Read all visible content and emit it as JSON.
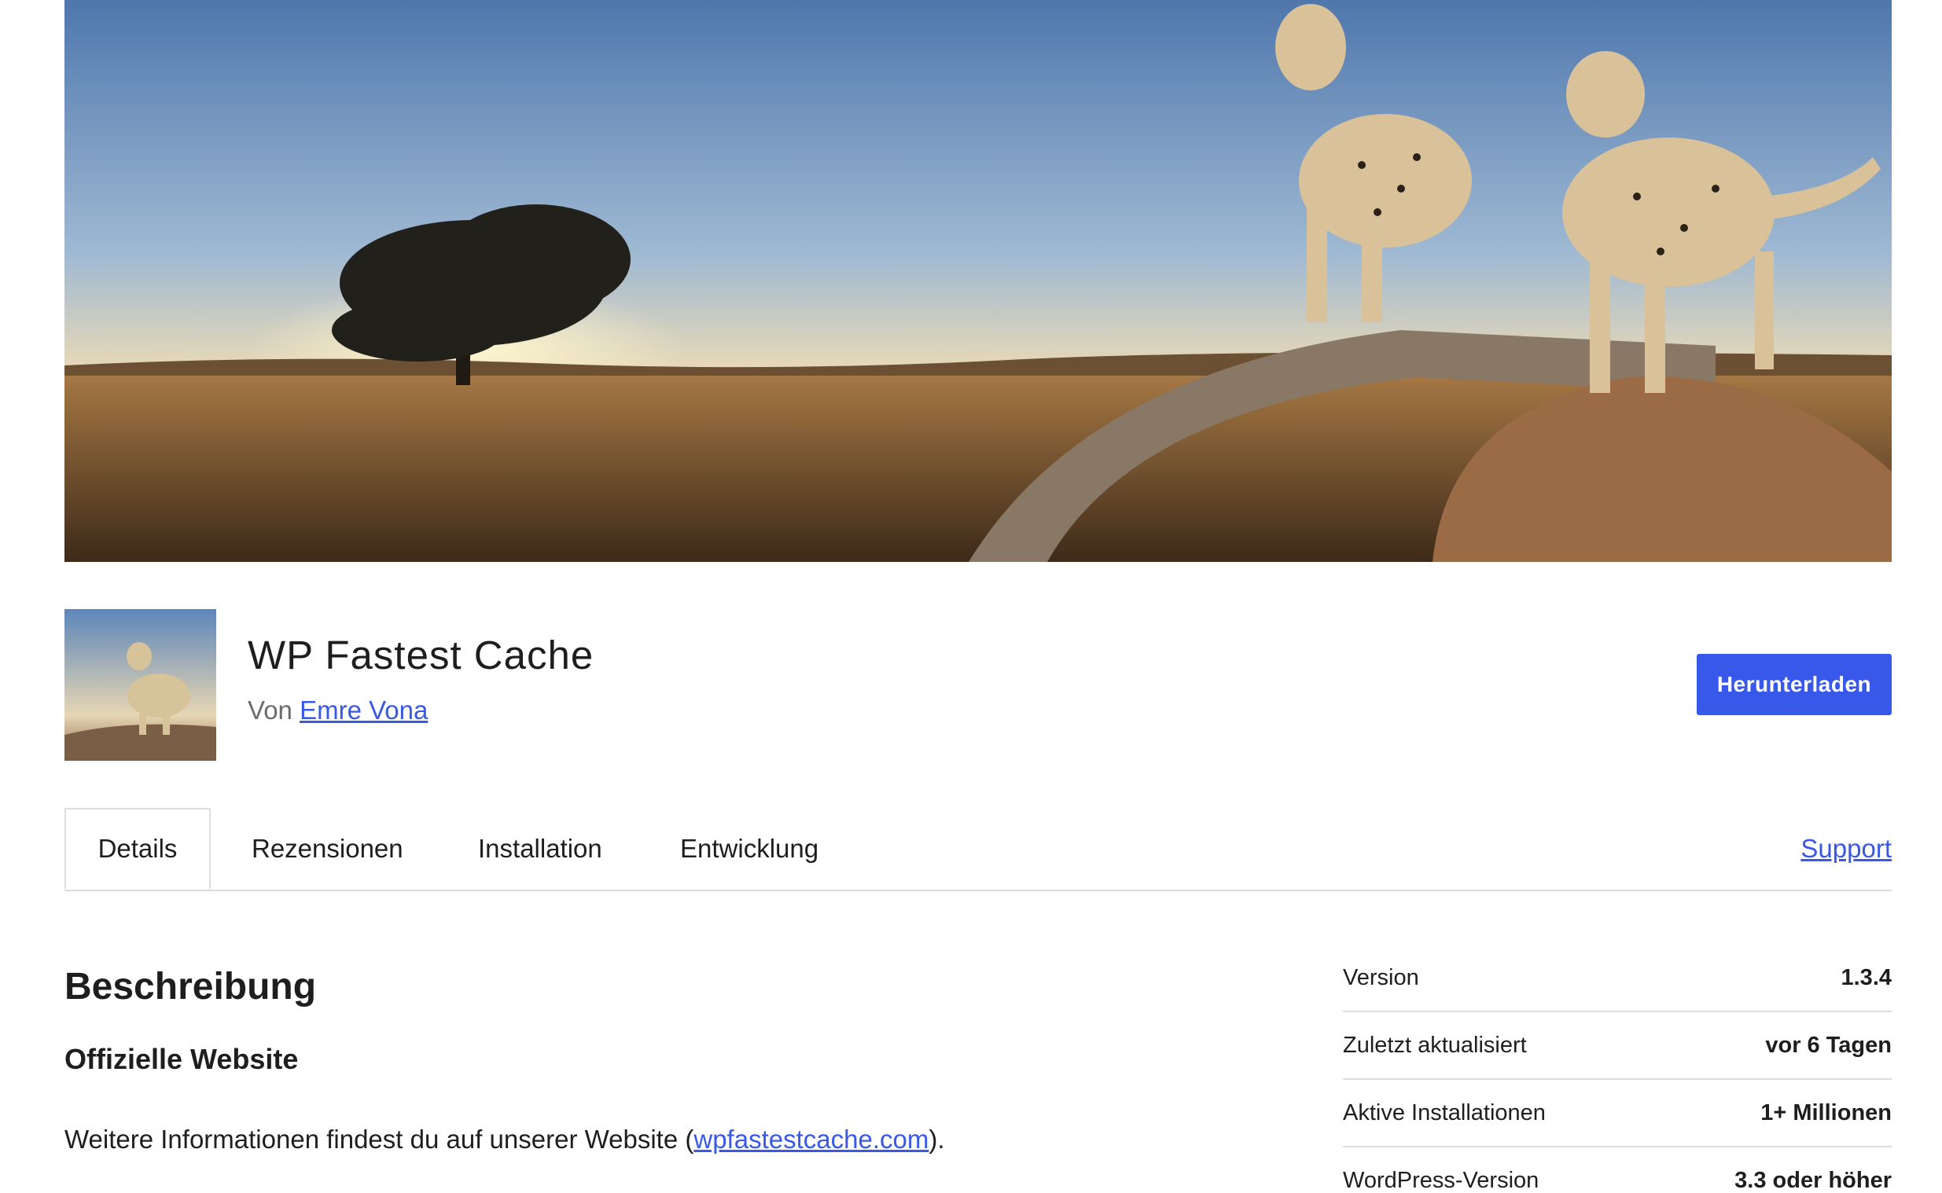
{
  "plugin": {
    "title": "WP Fastest Cache",
    "by_prefix": "Von",
    "author": "Emre Vona",
    "download_label": "Herunterladen"
  },
  "tabs": {
    "items": [
      {
        "label": "Details",
        "active": true
      },
      {
        "label": "Rezensionen",
        "active": false
      },
      {
        "label": "Installation",
        "active": false
      },
      {
        "label": "Entwicklung",
        "active": false
      }
    ],
    "support_label": "Support"
  },
  "description": {
    "heading": "Beschreibung",
    "subheading": "Offizielle Website",
    "text_before": "Weitere Informationen findest du auf unserer Website (",
    "link": "wpfastestcache.com",
    "text_after": ")."
  },
  "meta": {
    "rows": [
      {
        "key": "Version",
        "value": "1.3.4"
      },
      {
        "key": "Zuletzt aktualisiert",
        "value": "vor 6 Tagen"
      },
      {
        "key": "Aktive Installationen",
        "value": "1+ Millionen"
      },
      {
        "key": "WordPress-Version",
        "value": "3.3 oder höher"
      }
    ]
  },
  "colors": {
    "accent": "#3858e9",
    "text": "#1e1e1e",
    "muted": "#6b6b6b",
    "border": "#dcdcde"
  }
}
